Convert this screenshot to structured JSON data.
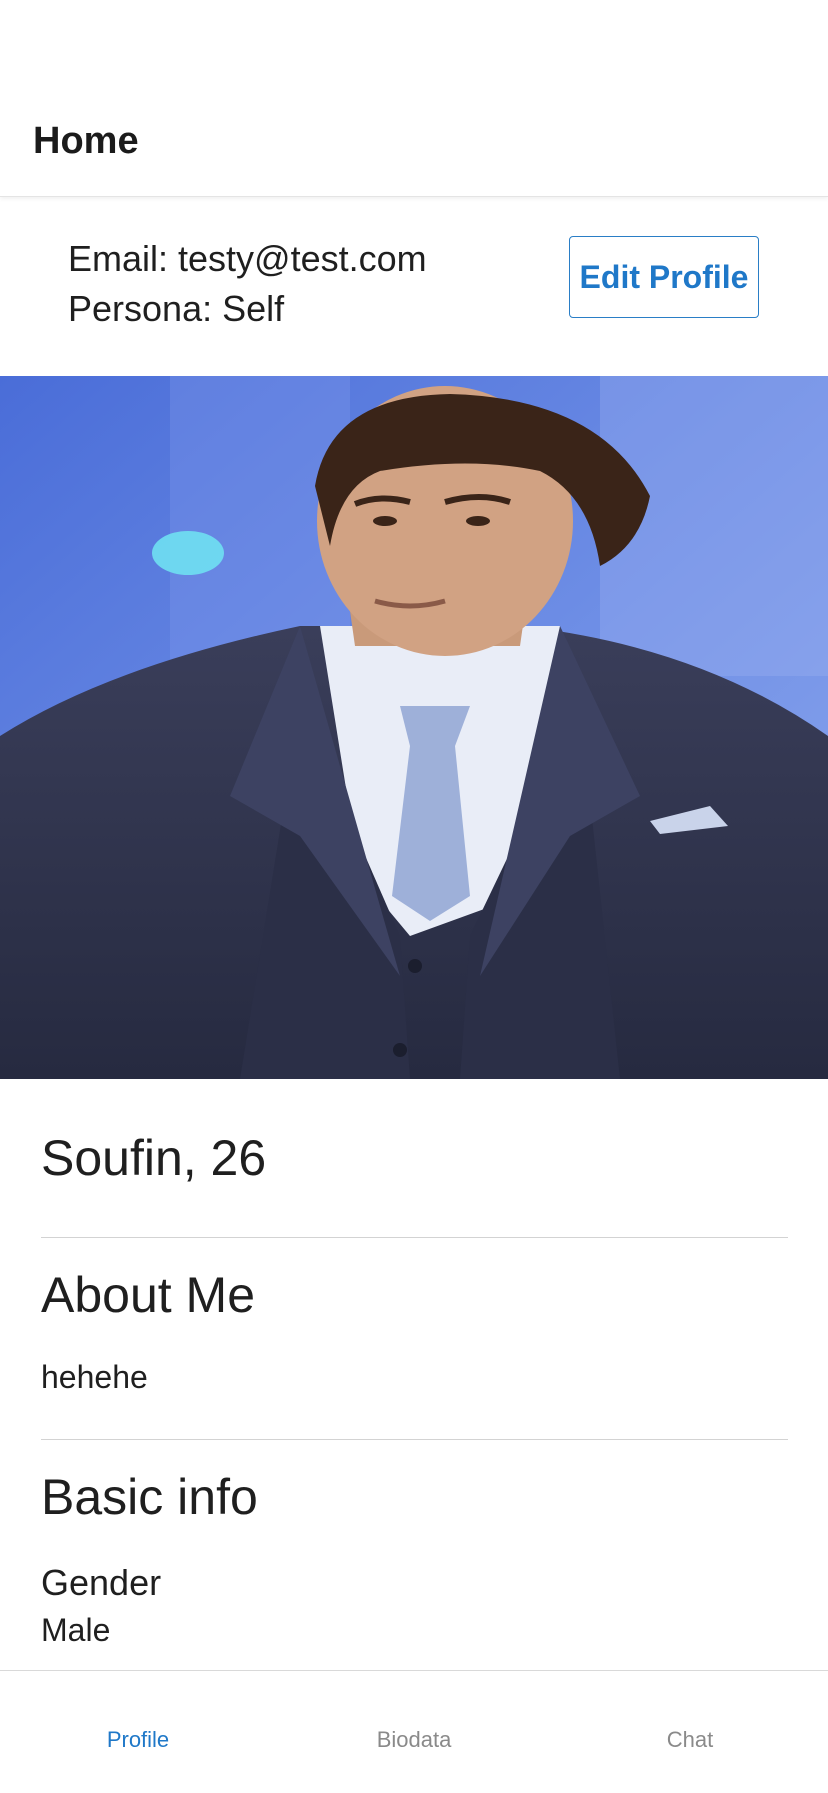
{
  "header": {
    "title": "Home"
  },
  "account": {
    "email_line": "Email: testy@test.com",
    "persona_line": "Persona: Self",
    "edit_button_label": "Edit Profile"
  },
  "profile_photo": {
    "subject": "man in navy three-piece suit with light blue tie against blue background"
  },
  "profile": {
    "name_age": "Soufin, 26",
    "about": {
      "title": "About Me",
      "text": "hehehe"
    },
    "basic_info": {
      "title": "Basic info",
      "fields": [
        {
          "label": "Gender",
          "value": "Male"
        }
      ]
    }
  },
  "tabs": [
    {
      "label": "Profile",
      "active": true
    },
    {
      "label": "Biodata",
      "active": false
    },
    {
      "label": "Chat",
      "active": false
    }
  ],
  "colors": {
    "accent": "#1f78c8",
    "inactive_tab": "#8a8a8a",
    "divider": "#d3d3d3",
    "photo_background": "#4f72d8",
    "suit": "#2d3148",
    "tie": "#9eb0d9"
  }
}
